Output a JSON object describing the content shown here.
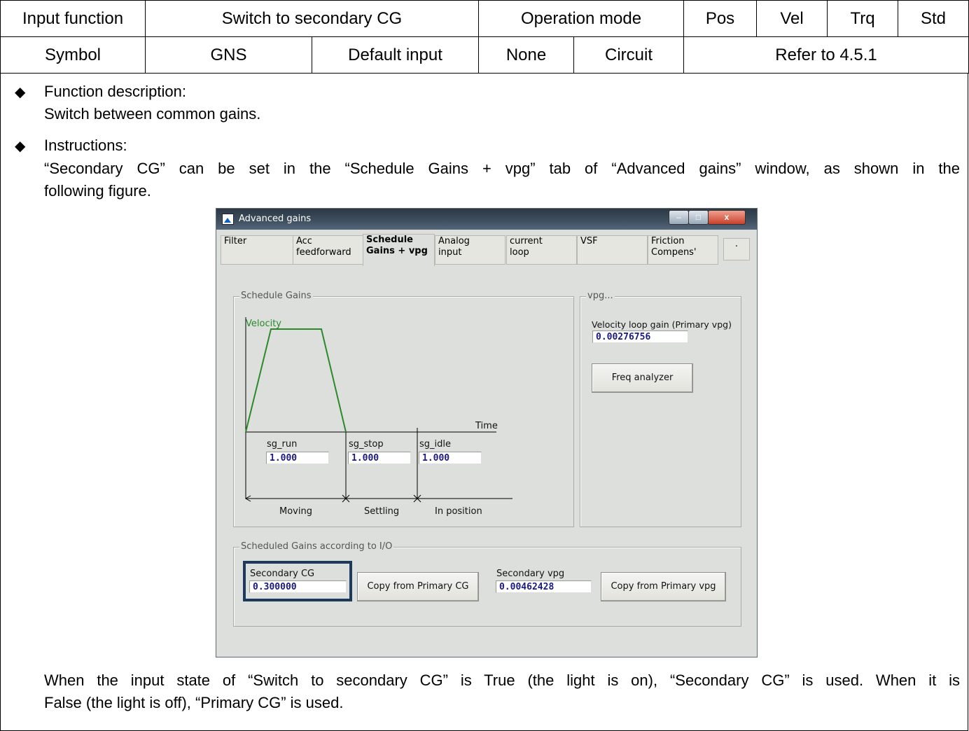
{
  "header": {
    "row1": {
      "input_function_label": "Input function",
      "input_function_value": "Switch to secondary CG",
      "operation_mode_label": "Operation mode",
      "modes": [
        "Pos",
        "Vel",
        "Trq",
        "Std"
      ]
    },
    "row2": {
      "symbol_label": "Symbol",
      "symbol_value": "GNS",
      "default_input_label": "Default input",
      "default_input_value": "None",
      "circuit_label": "Circuit",
      "circuit_value": "Refer to 4.5.1"
    }
  },
  "body": {
    "bullet_glyph": "◆",
    "func_heading": "Function description:",
    "func_text": "Switch between common gains.",
    "instr_heading": "Instructions:",
    "instr_text_line1": "“Secondary CG” can be set in the “Schedule Gains + vpg” tab of “Advanced gains” window, as shown in the",
    "instr_text_line2": "following figure.",
    "after_text_line1": "When the input state of “Switch to secondary CG” is True (the light is on), “Secondary CG” is used. When it is",
    "after_text_line2": "False (the light is off), “Primary CG” is used."
  },
  "window": {
    "title": "Advanced gains",
    "controls": {
      "minimize": "‒",
      "maximize": "□",
      "close": "x"
    },
    "tabs": [
      {
        "line1": "Filter",
        "line2": ""
      },
      {
        "line1": "Acc",
        "line2": "feedforward"
      },
      {
        "line1": "Schedule",
        "line2": "Gains + vpg"
      },
      {
        "line1": "Analog",
        "line2": "input"
      },
      {
        "line1": "current",
        "line2": "loop"
      },
      {
        "line1": "VSF",
        "line2": ""
      },
      {
        "line1": "Friction",
        "line2": "Compens'"
      },
      {
        "line1": ".",
        "line2": ""
      }
    ],
    "schedule_gains": {
      "group_label": "Schedule Gains",
      "velocity_label": "Velocity",
      "time_label": "Time",
      "sg_run_label": "sg_run",
      "sg_run_value": "1.000",
      "sg_stop_label": "sg_stop",
      "sg_stop_value": "1.000",
      "sg_idle_label": "sg_idle",
      "sg_idle_value": "1.000",
      "phase_moving": "Moving",
      "phase_settling": "Settling",
      "phase_in_position": "In position"
    },
    "vpg": {
      "group_label": "vpg...",
      "primary_label": "Velocity loop gain (Primary vpg)",
      "primary_value": "0.00276756",
      "freq_button": "Freq analyzer"
    },
    "io": {
      "group_label": "Scheduled Gains according to I/O",
      "secondary_cg_label": "Secondary CG",
      "secondary_cg_value": "0.300000",
      "copy_cg_button": "Copy from Primary CG",
      "secondary_vpg_label": "Secondary vpg",
      "secondary_vpg_value": "0.00462428",
      "copy_vpg_button": "Copy from Primary vpg"
    },
    "colors": {
      "velocity_curve": "#2a8a2a",
      "highlight_border": "#1c3a5c",
      "field_text": "#1a1a80"
    }
  }
}
